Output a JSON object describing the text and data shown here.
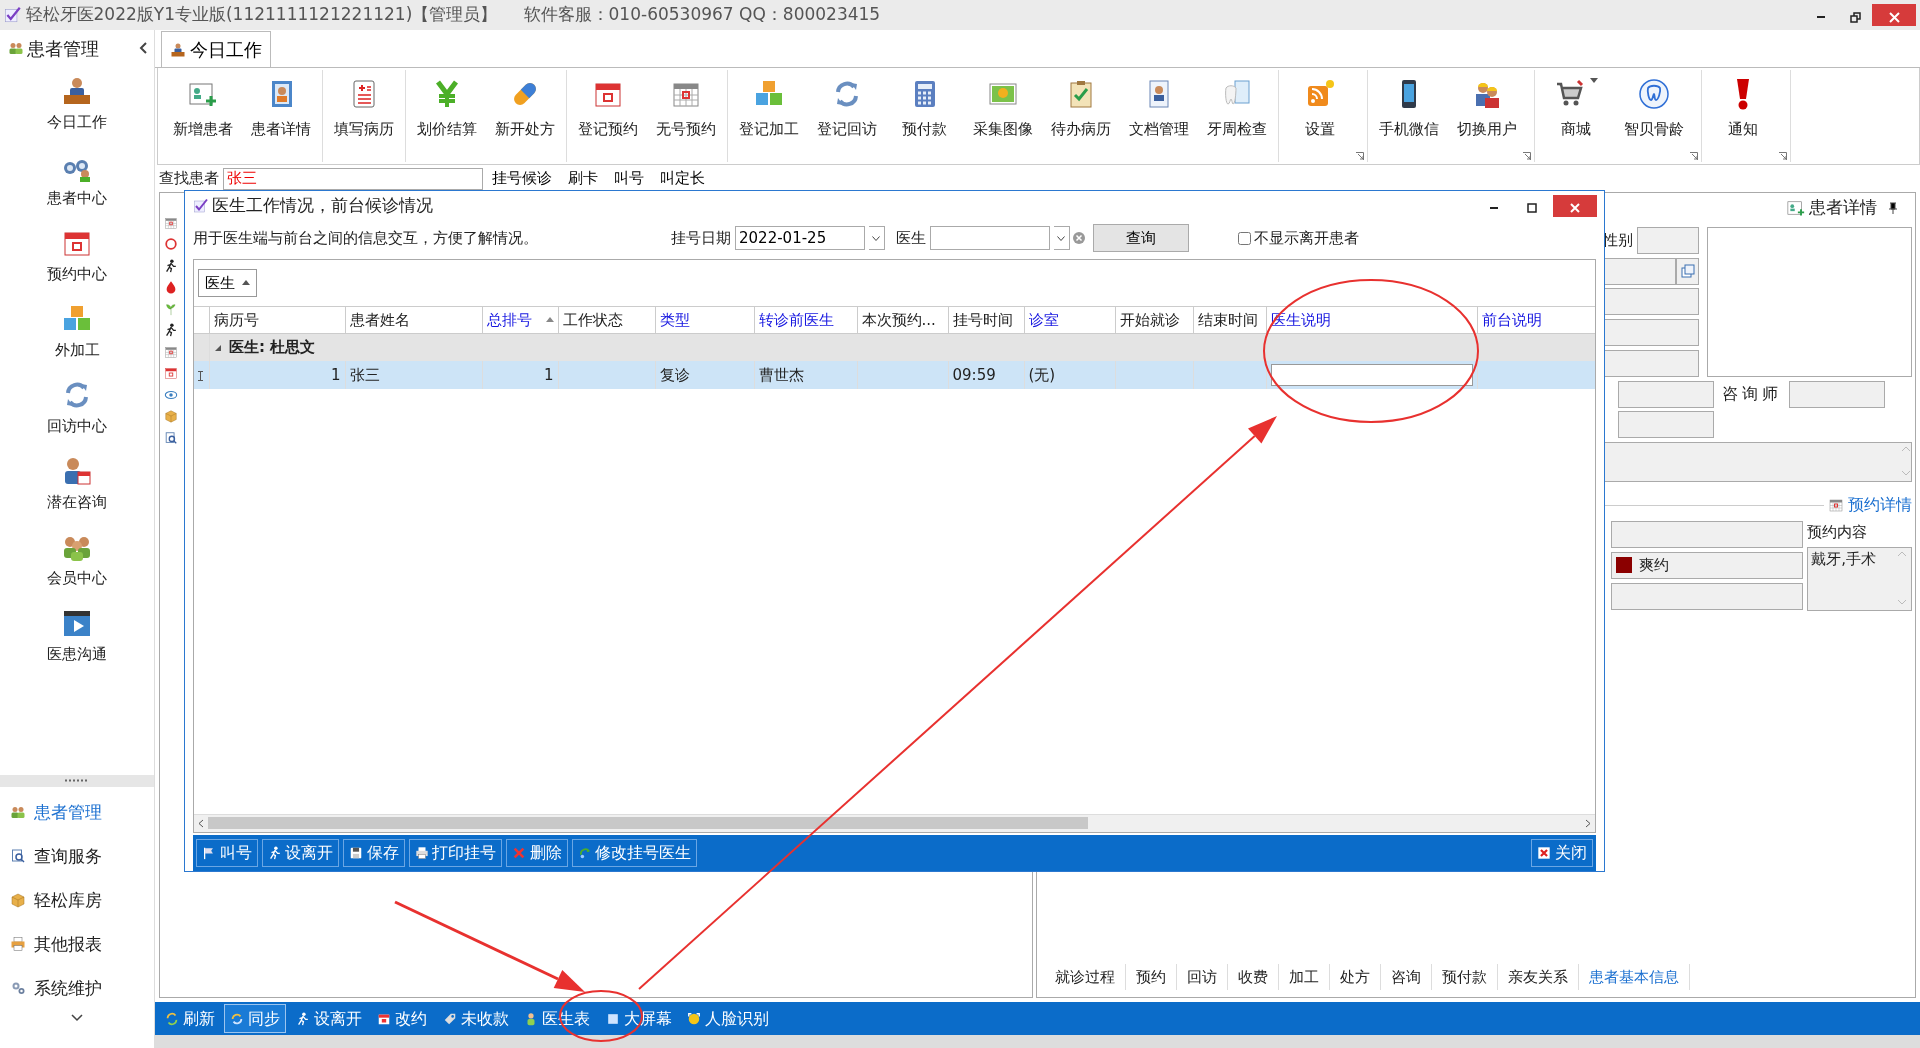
{
  "window": {
    "title": "轻松牙医2022版Y1专业版(1121111121221121)【管理员】",
    "support": "软件客服：010-60530967 QQ：800023415"
  },
  "sidebar": {
    "title": "患者管理",
    "modules": [
      {
        "label": "今日工作"
      },
      {
        "label": "患者中心"
      },
      {
        "label": "预约中心"
      },
      {
        "label": "外加工"
      },
      {
        "label": "回访中心"
      },
      {
        "label": "潜在咨询"
      },
      {
        "label": "会员中心"
      },
      {
        "label": "医患沟通"
      }
    ],
    "nav": [
      {
        "label": "患者管理",
        "selected": true
      },
      {
        "label": "查询服务",
        "selected": false
      },
      {
        "label": "轻松库房",
        "selected": false
      },
      {
        "label": "其他报表",
        "selected": false
      },
      {
        "label": "系统维护",
        "selected": false
      }
    ]
  },
  "tabs": [
    {
      "label": "今日工作",
      "selected": true
    }
  ],
  "ribbon": {
    "groups": [
      {
        "launcher": false,
        "items": [
          {
            "label": "新增患者",
            "menu": false
          },
          {
            "label": "患者详情",
            "menu": false
          }
        ]
      },
      {
        "launcher": false,
        "items": [
          {
            "label": "填写病历",
            "menu": false
          }
        ]
      },
      {
        "launcher": false,
        "items": [
          {
            "label": "划价结算",
            "menu": false
          },
          {
            "label": "新开处方",
            "menu": false
          }
        ]
      },
      {
        "launcher": false,
        "items": [
          {
            "label": "登记预约",
            "menu": false
          },
          {
            "label": "无号预约",
            "menu": false
          }
        ]
      },
      {
        "launcher": false,
        "items": [
          {
            "label": "登记加工",
            "menu": false
          },
          {
            "label": "登记回访",
            "menu": false
          },
          {
            "label": "预付款",
            "menu": false
          },
          {
            "label": "采集图像",
            "menu": false
          },
          {
            "label": "待办病历",
            "menu": false
          },
          {
            "label": "文档管理",
            "menu": false
          },
          {
            "label": "牙周检查",
            "menu": false
          }
        ]
      },
      {
        "launcher": true,
        "items": [
          {
            "label": "设置",
            "menu": false
          }
        ]
      },
      {
        "launcher": true,
        "items": [
          {
            "label": "手机微信",
            "menu": false
          },
          {
            "label": "切换用户",
            "menu": false
          }
        ]
      },
      {
        "launcher": true,
        "items": [
          {
            "label": "商城",
            "menu": true
          },
          {
            "label": "智贝骨龄",
            "menu": false
          }
        ]
      },
      {
        "launcher": true,
        "items": [
          {
            "label": "通知",
            "menu": false
          }
        ]
      }
    ]
  },
  "search": {
    "label": "查找患者",
    "value": "张三",
    "buttons": [
      "挂号候诊",
      "刷卡",
      "叫号",
      "叫定长"
    ]
  },
  "dialog": {
    "title": "医生工作情况，前台候诊情况",
    "description": "用于医生端与前台之间的信息交互，方便了解情况。",
    "date_label": "挂号日期",
    "date": "2022-01-25",
    "doctor_label": "医生",
    "query_button": "查询",
    "hide_left": {
      "label": "不显示离开患者",
      "checked": false
    },
    "group_by": "医生",
    "columns": [
      {
        "label": "病历号",
        "editable": false,
        "sorted": false
      },
      {
        "label": "患者姓名",
        "editable": false,
        "sorted": false
      },
      {
        "label": "总排号",
        "editable": true,
        "sorted": true
      },
      {
        "label": "工作状态",
        "editable": false,
        "sorted": false
      },
      {
        "label": "类型",
        "editable": true,
        "sorted": false
      },
      {
        "label": "转诊前医生",
        "editable": true,
        "sorted": false
      },
      {
        "label": "本次预约...",
        "editable": false,
        "sorted": false
      },
      {
        "label": "挂号时间",
        "editable": false,
        "sorted": false
      },
      {
        "label": "诊室",
        "editable": true,
        "sorted": false
      },
      {
        "label": "开始就诊",
        "editable": false,
        "sorted": false
      },
      {
        "label": "结束时间",
        "editable": false,
        "sorted": false
      },
      {
        "label": "医生说明",
        "editable": true,
        "sorted": false
      },
      {
        "label": "前台说明",
        "editable": true,
        "sorted": false
      }
    ],
    "groups": [
      {
        "label": "医生: 杜思文",
        "expanded": true,
        "rows": [
          {
            "selected": true,
            "cells": [
              {
                "text": "1",
                "editing": false
              },
              {
                "text": "张三",
                "editing": false
              },
              {
                "text": "1",
                "editing": false
              },
              {
                "editing": false
              },
              {
                "text": "复诊",
                "editing": false
              },
              {
                "text": "曹世杰",
                "editing": false
              },
              {
                "editing": false
              },
              {
                "text": "09:59",
                "editing": false
              },
              {
                "text": "(无)",
                "editing": false
              },
              {
                "editing": false
              },
              {
                "editing": false
              },
              {
                "editing": true
              },
              {
                "editing": false
              }
            ]
          }
        ]
      }
    ],
    "footer_buttons": [
      "叫号",
      "设离开",
      "保存",
      "打印挂号",
      "删除",
      "修改挂号医生"
    ],
    "close_button": "关闭"
  },
  "patient_panel": {
    "title": "患者详情",
    "gender_label": "性别",
    "consultant_label": "咨询师",
    "appointment": {
      "title": "预约详情",
      "status": {
        "text": "爽约",
        "color": "#8b0000"
      },
      "content_label": "预约内容",
      "content": "戴牙,手术"
    },
    "tabs": [
      {
        "label": "就诊过程",
        "selected": false
      },
      {
        "label": "预约",
        "selected": false
      },
      {
        "label": "回访",
        "selected": false
      },
      {
        "label": "收费",
        "selected": false
      },
      {
        "label": "加工",
        "selected": false
      },
      {
        "label": "处方",
        "selected": false
      },
      {
        "label": "咨询",
        "selected": false
      },
      {
        "label": "预付款",
        "selected": false
      },
      {
        "label": "亲友关系",
        "selected": false
      },
      {
        "label": "患者基本信息",
        "selected": true
      }
    ]
  },
  "status_bar": {
    "buttons": [
      {
        "label": "刷新",
        "pressed": false
      },
      {
        "label": "同步",
        "pressed": true
      },
      {
        "label": "设离开",
        "pressed": false
      },
      {
        "label": "改约",
        "pressed": false
      },
      {
        "label": "未收款",
        "pressed": false
      },
      {
        "label": "医生表",
        "pressed": false
      },
      {
        "label": "大屏幕",
        "pressed": false
      },
      {
        "label": "人脸识别",
        "pressed": false
      }
    ]
  }
}
